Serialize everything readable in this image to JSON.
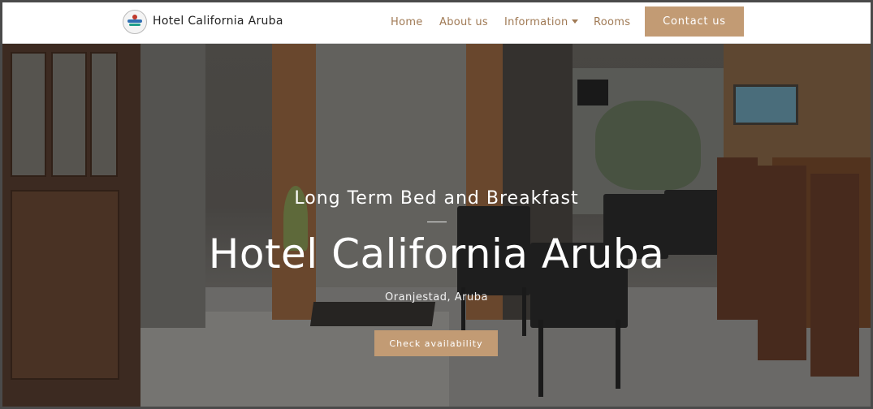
{
  "header": {
    "brand": "Hotel California Aruba",
    "logo_icon": "hotel-logo-icon",
    "nav": [
      {
        "label": "Home"
      },
      {
        "label": "About us"
      },
      {
        "label": "Information",
        "has_dropdown": true
      },
      {
        "label": "Rooms"
      }
    ],
    "contact_label": "Contact us"
  },
  "hero": {
    "tagline": "Long Term Bed and Breakfast",
    "title": "Hotel California Aruba",
    "location": "Oranjestad, Aruba",
    "cta_label": "Check availability"
  },
  "colors": {
    "accent": "#c29b74",
    "nav_text": "#a07a55",
    "header_bg": "#ffffff",
    "hero_text": "#ffffff"
  }
}
